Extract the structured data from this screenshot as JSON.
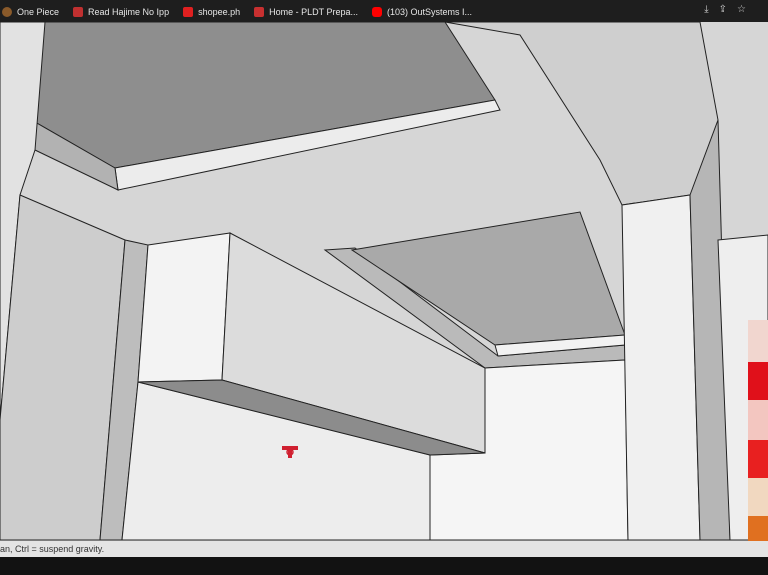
{
  "bookmarks": [
    {
      "label": "One Piece",
      "icon": "one-piece-favicon",
      "color": "#8a5a2a"
    },
    {
      "label": "Read Hajime No Ipp",
      "icon": "manga-favicon",
      "color": "#c03030"
    },
    {
      "label": "shopee.ph",
      "icon": "shopee-favicon",
      "color": "#e02020"
    },
    {
      "label": "Home - PLDT Prepa...",
      "icon": "pldt-favicon",
      "color": "#c83030"
    },
    {
      "label": "(103) OutSystems I...",
      "icon": "youtube-favicon",
      "color": "#ff0000"
    }
  ],
  "browser_actions": [
    "download-icon",
    "share-icon",
    "star-icon"
  ],
  "status": {
    "text": "an, Ctrl = suspend gravity."
  },
  "swatches": [
    "#f1d6cf",
    "#e0101a",
    "#f3c6c0",
    "#e82020",
    "#f1d8c0",
    "#e07020"
  ]
}
